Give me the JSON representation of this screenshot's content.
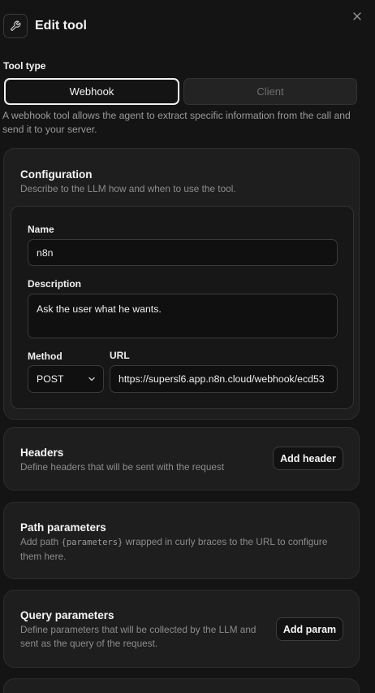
{
  "dialog": {
    "title": "Edit tool",
    "tool_icon": "wrench-icon",
    "close_icon": "close-icon"
  },
  "tool_type": {
    "label": "Tool type",
    "options": [
      "Webhook",
      "Client"
    ],
    "selected": "Webhook",
    "description": "A webhook tool allows the agent to extract specific information from the call and send it to your server."
  },
  "configuration": {
    "title": "Configuration",
    "description": "Describe to the LLM how and when to use the tool.",
    "name_label": "Name",
    "name_value": "n8n",
    "description_label": "Description",
    "description_value": "Ask the user what he wants.",
    "method_label": "Method",
    "method_value": "POST",
    "url_label": "URL",
    "url_value": "https://supersl6.app.n8n.cloud/webhook/ecd53"
  },
  "headers": {
    "title": "Headers",
    "description": "Define headers that will be sent with the request",
    "button": "Add header"
  },
  "path_parameters": {
    "title": "Path parameters",
    "desc_before": "Add path ",
    "desc_code": "{parameters}",
    "desc_after": " wrapped in curly braces to the URL to configure them here."
  },
  "query_parameters": {
    "title": "Query parameters",
    "description": "Define parameters that will be collected by the LLM and sent as the query of the request.",
    "button": "Add param"
  },
  "colors": {
    "background": "#141414",
    "card": "#1e1e1e",
    "text": "#f5f5f5",
    "muted": "#8c8c8c"
  }
}
